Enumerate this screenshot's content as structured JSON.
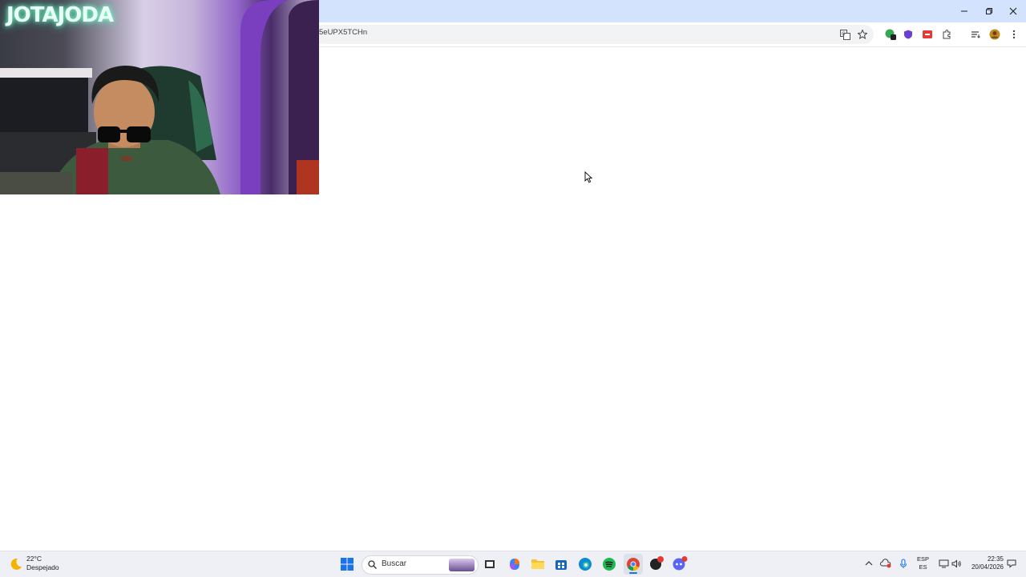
{
  "browser": {
    "url": "5eUPX5TCHn",
    "toolbar_icons": [
      "translate-icon",
      "bookmark-star-icon",
      "extension-shield-icon",
      "extension-brave-icon",
      "extension-red-icon",
      "extensions-puzzle-icon",
      "reading-list-icon",
      "profile-avatar-icon",
      "menu-icon"
    ]
  },
  "webcam": {
    "neon_sign": "JOTAJODA"
  },
  "taskbar": {
    "weather_temp": "22°C",
    "weather_desc": "Despejado",
    "search_placeholder": "Buscar",
    "lang_top": "ESP",
    "lang_bottom": "ES",
    "time": "22:35",
    "date": "20/04/2026",
    "apps": [
      "windows-start-icon",
      "search-icon",
      "task-view-icon",
      "copilot-icon",
      "file-explorer-icon",
      "microsoft-store-icon",
      "edge-icon",
      "spotify-icon",
      "chrome-icon",
      "app-icon",
      "discord-icon"
    ]
  },
  "colors": {
    "titlebar": "#d3e3fd",
    "taskbar": "#eef0f5"
  }
}
